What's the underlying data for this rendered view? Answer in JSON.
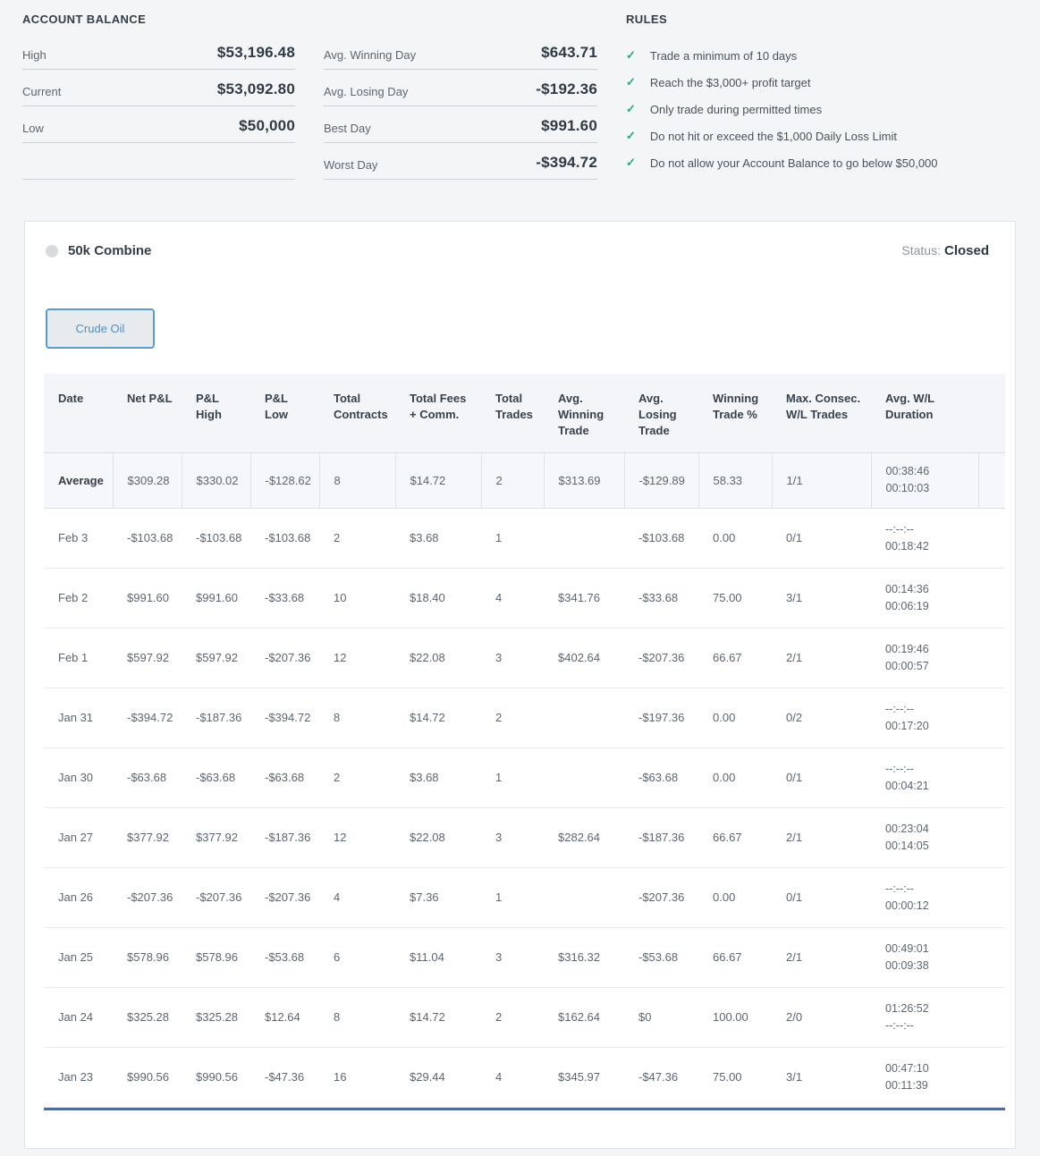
{
  "colors": {
    "accent_blue": "#4a90d2",
    "check_green": "#27a683",
    "table_bottom_accent": "#3e6dc3",
    "status_dot_gray": "#d8dbde"
  },
  "account_balance": {
    "title": "ACCOUNT BALANCE",
    "stats": [
      {
        "label": "High",
        "value": "$53,196.48"
      },
      {
        "label": "Current",
        "value": "$53,092.80"
      },
      {
        "label": "Low",
        "value": "$50,000"
      }
    ]
  },
  "day_stats": [
    {
      "label": "Avg. Winning Day",
      "value": "$643.71"
    },
    {
      "label": "Avg. Losing Day",
      "value": "-$192.36"
    },
    {
      "label": "Best Day",
      "value": "$991.60"
    },
    {
      "label": "Worst Day",
      "value": "-$394.72"
    }
  ],
  "rules": {
    "title": "RULES",
    "check_glyph": "✓",
    "items": [
      "Trade a minimum of 10 days",
      "Reach the $3,000+ profit target",
      "Only trade during permitted times",
      "Do not hit or exceed the $1,000 Daily Loss Limit",
      "Do not allow your Account Balance to go below $50,000"
    ]
  },
  "combine": {
    "title": "50k Combine",
    "status_label": "Status:",
    "status_value": "Closed",
    "tab_label": "Crude Oil"
  },
  "table": {
    "columns": [
      "Date",
      "Net P&L",
      "P&L\nHigh",
      "P&L\nLow",
      "Total\nContracts",
      "Total Fees\n+ Comm.",
      "Total\nTrades",
      "Avg.\nWinning\nTrade",
      "Avg.\nLosing\nTrade",
      "Winning\nTrade %",
      "Max. Consec.\nW/L Trades",
      "Avg. W/L\nDuration"
    ],
    "average_row": {
      "date": "Average",
      "net_pnl": "$309.28",
      "pnl_high": "$330.02",
      "pnl_low": "-$128.62",
      "contracts": "8",
      "fees": "$14.72",
      "trades": "2",
      "avg_win": "$313.69",
      "avg_lose": "-$129.89",
      "win_pct": "58.33",
      "consec": "1/1",
      "dur_win": "00:38:46",
      "dur_loss": "00:10:03"
    },
    "rows": [
      {
        "date": "Feb 3",
        "net_pnl": "-$103.68",
        "pnl_high": "-$103.68",
        "pnl_low": "-$103.68",
        "contracts": "2",
        "fees": "$3.68",
        "trades": "1",
        "avg_win": "",
        "avg_lose": "-$103.68",
        "win_pct": "0.00",
        "consec": "0/1",
        "dur_win": "--:--:--",
        "dur_loss": "00:18:42"
      },
      {
        "date": "Feb 2",
        "net_pnl": "$991.60",
        "pnl_high": "$991.60",
        "pnl_low": "-$33.68",
        "contracts": "10",
        "fees": "$18.40",
        "trades": "4",
        "avg_win": "$341.76",
        "avg_lose": "-$33.68",
        "win_pct": "75.00",
        "consec": "3/1",
        "dur_win": "00:14:36",
        "dur_loss": "00:06:19"
      },
      {
        "date": "Feb 1",
        "net_pnl": "$597.92",
        "pnl_high": "$597.92",
        "pnl_low": "-$207.36",
        "contracts": "12",
        "fees": "$22.08",
        "trades": "3",
        "avg_win": "$402.64",
        "avg_lose": "-$207.36",
        "win_pct": "66.67",
        "consec": "2/1",
        "dur_win": "00:19:46",
        "dur_loss": "00:00:57"
      },
      {
        "date": "Jan 31",
        "net_pnl": "-$394.72",
        "pnl_high": "-$187.36",
        "pnl_low": "-$394.72",
        "contracts": "8",
        "fees": "$14.72",
        "trades": "2",
        "avg_win": "",
        "avg_lose": "-$197.36",
        "win_pct": "0.00",
        "consec": "0/2",
        "dur_win": "--:--:--",
        "dur_loss": "00:17:20"
      },
      {
        "date": "Jan 30",
        "net_pnl": "-$63.68",
        "pnl_high": "-$63.68",
        "pnl_low": "-$63.68",
        "contracts": "2",
        "fees": "$3.68",
        "trades": "1",
        "avg_win": "",
        "avg_lose": "-$63.68",
        "win_pct": "0.00",
        "consec": "0/1",
        "dur_win": "--:--:--",
        "dur_loss": "00:04:21"
      },
      {
        "date": "Jan 27",
        "net_pnl": "$377.92",
        "pnl_high": "$377.92",
        "pnl_low": "-$187.36",
        "contracts": "12",
        "fees": "$22.08",
        "trades": "3",
        "avg_win": "$282.64",
        "avg_lose": "-$187.36",
        "win_pct": "66.67",
        "consec": "2/1",
        "dur_win": "00:23:04",
        "dur_loss": "00:14:05"
      },
      {
        "date": "Jan 26",
        "net_pnl": "-$207.36",
        "pnl_high": "-$207.36",
        "pnl_low": "-$207.36",
        "contracts": "4",
        "fees": "$7.36",
        "trades": "1",
        "avg_win": "",
        "avg_lose": "-$207.36",
        "win_pct": "0.00",
        "consec": "0/1",
        "dur_win": "--:--:--",
        "dur_loss": "00:00:12"
      },
      {
        "date": "Jan 25",
        "net_pnl": "$578.96",
        "pnl_high": "$578.96",
        "pnl_low": "-$53.68",
        "contracts": "6",
        "fees": "$11.04",
        "trades": "3",
        "avg_win": "$316.32",
        "avg_lose": "-$53.68",
        "win_pct": "66.67",
        "consec": "2/1",
        "dur_win": "00:49:01",
        "dur_loss": "00:09:38"
      },
      {
        "date": "Jan 24",
        "net_pnl": "$325.28",
        "pnl_high": "$325.28",
        "pnl_low": "$12.64",
        "contracts": "8",
        "fees": "$14.72",
        "trades": "2",
        "avg_win": "$162.64",
        "avg_lose": "$0",
        "win_pct": "100.00",
        "consec": "2/0",
        "dur_win": "01:26:52",
        "dur_loss": "--:--:--"
      },
      {
        "date": "Jan 23",
        "net_pnl": "$990.56",
        "pnl_high": "$990.56",
        "pnl_low": "-$47.36",
        "contracts": "16",
        "fees": "$29.44",
        "trades": "4",
        "avg_win": "$345.97",
        "avg_lose": "-$47.36",
        "win_pct": "75.00",
        "consec": "3/1",
        "dur_win": "00:47:10",
        "dur_loss": "00:11:39"
      }
    ]
  }
}
